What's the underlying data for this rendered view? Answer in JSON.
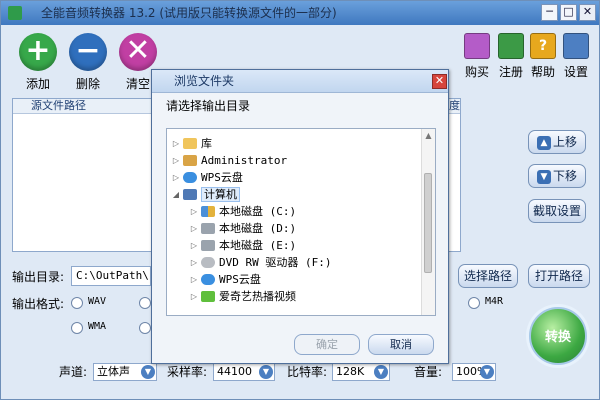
{
  "window": {
    "title": "全能音频转换器 13.2 (试用版只能转换源文件的一部分)",
    "controls": {
      "minimize": "─",
      "maximize": "□",
      "close": "✕"
    }
  },
  "toolbar": {
    "add": {
      "label": "添加",
      "glyph": "+"
    },
    "delete": {
      "label": "删除",
      "glyph": "−"
    },
    "clear": {
      "label": "清空",
      "glyph": "✕"
    },
    "buy": {
      "label": "购买"
    },
    "register": {
      "label": "注册"
    },
    "help": {
      "label": "帮助",
      "glyph": "?"
    },
    "settings": {
      "label": "设置"
    }
  },
  "filelist": {
    "columns": [
      "源文件路径",
      "度"
    ]
  },
  "side_buttons": {
    "move_up": {
      "label": "上移",
      "glyph": "▲"
    },
    "move_down": {
      "label": "下移",
      "glyph": "▼"
    },
    "capture_settings": {
      "label": "截取设置"
    },
    "choose_path": {
      "label": "选择路径"
    },
    "open_path": {
      "label": "打开路径"
    }
  },
  "output": {
    "dir_label": "输出目录:",
    "dir_value": "C:\\OutPath\\",
    "format_label": "输出格式:",
    "formats": {
      "wav": "WAV",
      "wma": "WMA",
      "m4r": "M4R"
    }
  },
  "convert": {
    "label": "转换"
  },
  "bottom": {
    "channel_label": "声道:",
    "channel_value": "立体声",
    "samplerate_label": "采样率:",
    "samplerate_value": "44100",
    "bitrate_label": "比特率:",
    "bitrate_value": "128K",
    "volume_label": "音量:",
    "volume_value": "100%"
  },
  "dialog": {
    "title": "浏览文件夹",
    "prompt": "请选择输出目录",
    "tree": [
      {
        "label": "库"
      },
      {
        "label": "Administrator"
      },
      {
        "label": "WPS云盘"
      },
      {
        "label": "计算机"
      },
      {
        "label": "本地磁盘 (C:)"
      },
      {
        "label": "本地磁盘 (D:)"
      },
      {
        "label": "本地磁盘 (E:)"
      },
      {
        "label": "DVD RW 驱动器 (F:)"
      },
      {
        "label": "WPS云盘"
      },
      {
        "label": "爱奇艺热播视频"
      }
    ],
    "ok_label": "确定",
    "cancel_label": "取消"
  },
  "colors": {
    "add": "#37a84a",
    "delete": "#2f6fbd",
    "clear": "#c13fa3",
    "titlebar": "#4a86cf",
    "window_bg": "#dfe9f5"
  }
}
